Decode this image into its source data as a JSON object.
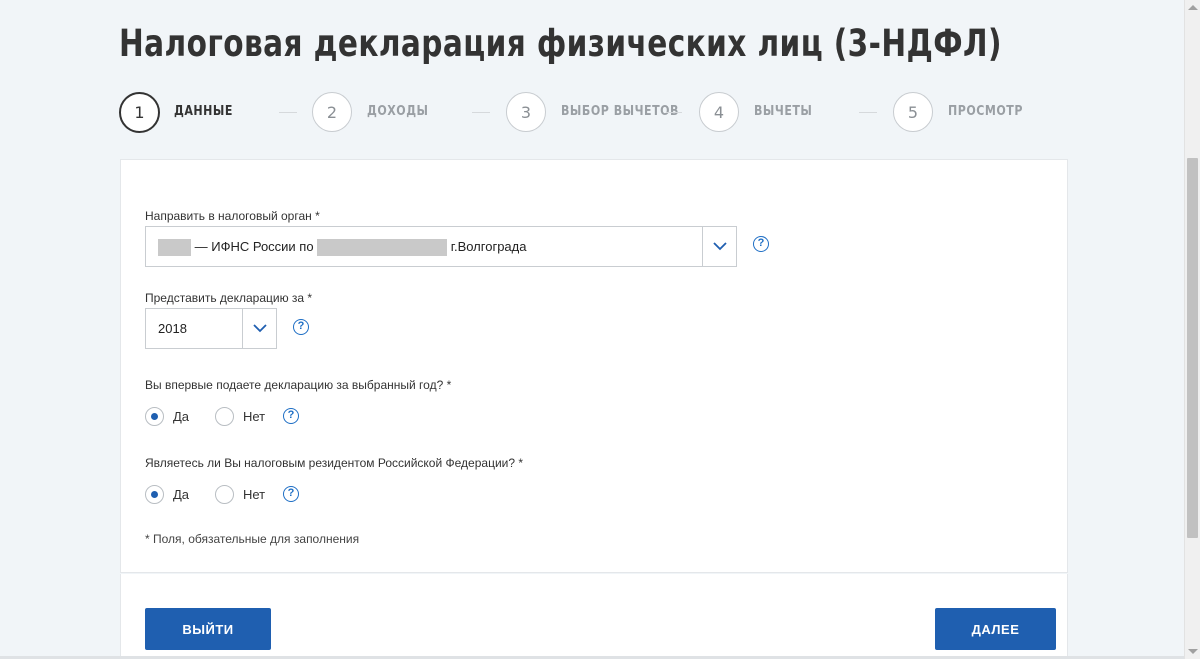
{
  "page": {
    "title": "Налоговая декларация физических лиц (3-НДФЛ)"
  },
  "steps": [
    {
      "number": "1",
      "label": "ДАННЫЕ",
      "active": true
    },
    {
      "number": "2",
      "label": "ДОХОДЫ",
      "active": false
    },
    {
      "number": "3",
      "label": "ВЫБОР ВЫЧЕТОВ",
      "active": false
    },
    {
      "number": "4",
      "label": "ВЫЧЕТЫ",
      "active": false
    },
    {
      "number": "5",
      "label": "ПРОСМОТР",
      "active": false
    }
  ],
  "form": {
    "tax_office": {
      "label": "Направить в налоговый орган *",
      "value_middle": " — ИФНС России по ",
      "value_end": " г.Волгограда"
    },
    "year": {
      "label": "Представить декларацию за *",
      "value": "2018"
    },
    "first_time": {
      "question": "Вы впервые подаете декларацию за выбранный год? *",
      "options": [
        {
          "label": "Да",
          "checked": true
        },
        {
          "label": "Нет",
          "checked": false
        }
      ]
    },
    "resident": {
      "question": "Являетесь ли Вы налоговым резидентом Российской Федерации? *",
      "options": [
        {
          "label": "Да",
          "checked": true
        },
        {
          "label": "Нет",
          "checked": false
        }
      ]
    },
    "required_note": "* Поля, обязательные для заполнения"
  },
  "buttons": {
    "exit": "ВЫЙТИ",
    "next": "ДАЛЕЕ"
  },
  "icons": {
    "help": "question-circle-icon",
    "chevron": "chevron-down-icon"
  },
  "colors": {
    "accent": "#1f5fb0",
    "help": "#1f6fc5",
    "background": "#f1f5f8"
  }
}
